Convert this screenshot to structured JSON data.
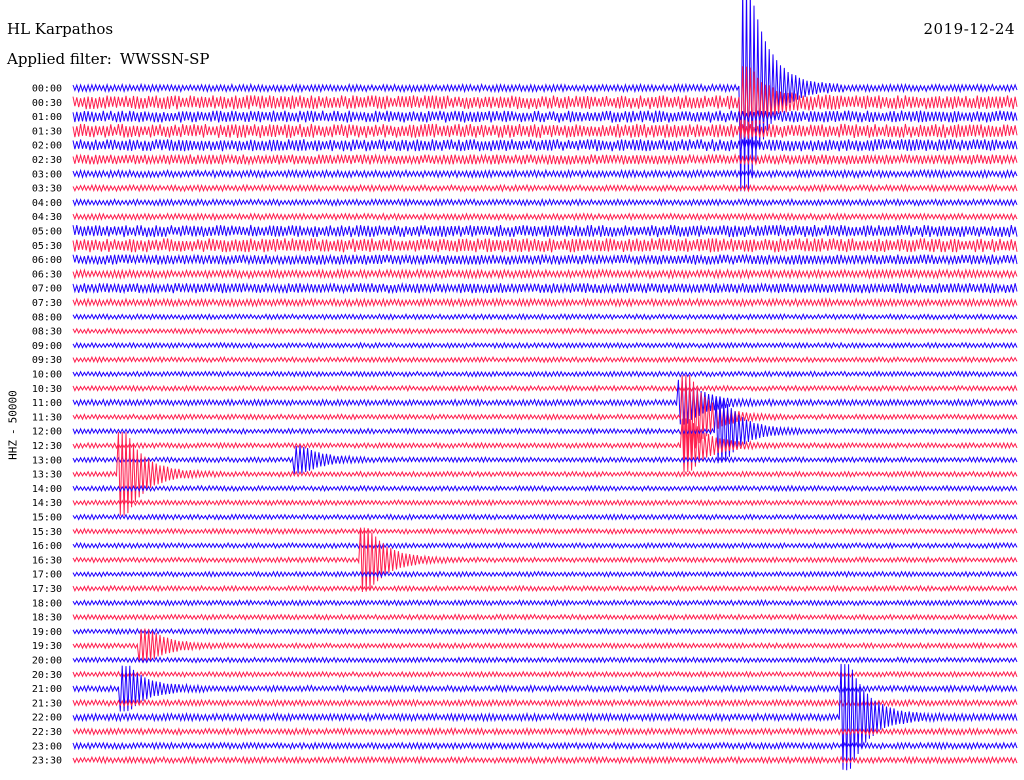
{
  "header": {
    "station": "HL Karpathos",
    "date": "2019-12-24",
    "filter_label": "Applied filter:",
    "filter_value": "WWSSN-SP"
  },
  "side_label": {
    "channel": "HHZ",
    "separator": "-",
    "scale": "50000"
  },
  "colors": {
    "trace_a": "#1f00ff",
    "trace_b": "#ff1f4f",
    "background": "#ffffff"
  },
  "chart_data": {
    "type": "line",
    "title": "HL Karpathos",
    "rows": [
      "00:00",
      "00:30",
      "01:00",
      "01:30",
      "02:00",
      "02:30",
      "03:00",
      "03:30",
      "04:00",
      "04:30",
      "05:00",
      "05:30",
      "06:00",
      "06:30",
      "07:00",
      "07:30",
      "08:00",
      "08:30",
      "09:00",
      "09:30",
      "10:00",
      "10:30",
      "11:00",
      "11:30",
      "12:00",
      "12:30",
      "13:00",
      "13:30",
      "14:00",
      "14:30",
      "15:00",
      "15:30",
      "16:00",
      "16:30",
      "17:00",
      "17:30",
      "18:00",
      "18:30",
      "19:00",
      "19:30",
      "20:00",
      "20:30",
      "21:00",
      "21:30",
      "22:00",
      "22:30",
      "23:00",
      "23:30"
    ],
    "minutes_per_row": 30,
    "series": [
      {
        "values": []
      },
      {
        "values": []
      }
    ],
    "noise_level": [
      3.5,
      7,
      6,
      7,
      6,
      5,
      3.5,
      3,
      3,
      3,
      6,
      7,
      5,
      4,
      5,
      3.5,
      2.5,
      2.5,
      2.5,
      2.5,
      2.5,
      2.5,
      3,
      2.5,
      2.5,
      2.5,
      2.5,
      2.5,
      2.5,
      2.5,
      2.5,
      2.5,
      2.5,
      2.5,
      2.5,
      2.5,
      2.5,
      2.5,
      2.5,
      2.5,
      2.5,
      2.5,
      3,
      3,
      3.5,
      3,
      3,
      3
    ],
    "events": [
      {
        "row": 0,
        "minute": 21.5,
        "amplitude": 100
      },
      {
        "row": 1,
        "minute": 21.5,
        "amplitude": 30
      },
      {
        "row": 22,
        "minute": 19.5,
        "amplitude": 20
      },
      {
        "row": 23,
        "minute": 19.6,
        "amplitude": 40
      },
      {
        "row": 24,
        "minute": 20.7,
        "amplitude": 30
      },
      {
        "row": 25,
        "minute": 19.6,
        "amplitude": 25
      },
      {
        "row": 26,
        "minute": 7.3,
        "amplitude": 12
      },
      {
        "row": 27,
        "minute": 1.7,
        "amplitude": 40
      },
      {
        "row": 33,
        "minute": 9.4,
        "amplitude": 30
      },
      {
        "row": 39,
        "minute": 2.4,
        "amplitude": 15
      },
      {
        "row": 42,
        "minute": 1.8,
        "amplitude": 20
      },
      {
        "row": 44,
        "minute": 24.7,
        "amplitude": 50
      }
    ]
  }
}
